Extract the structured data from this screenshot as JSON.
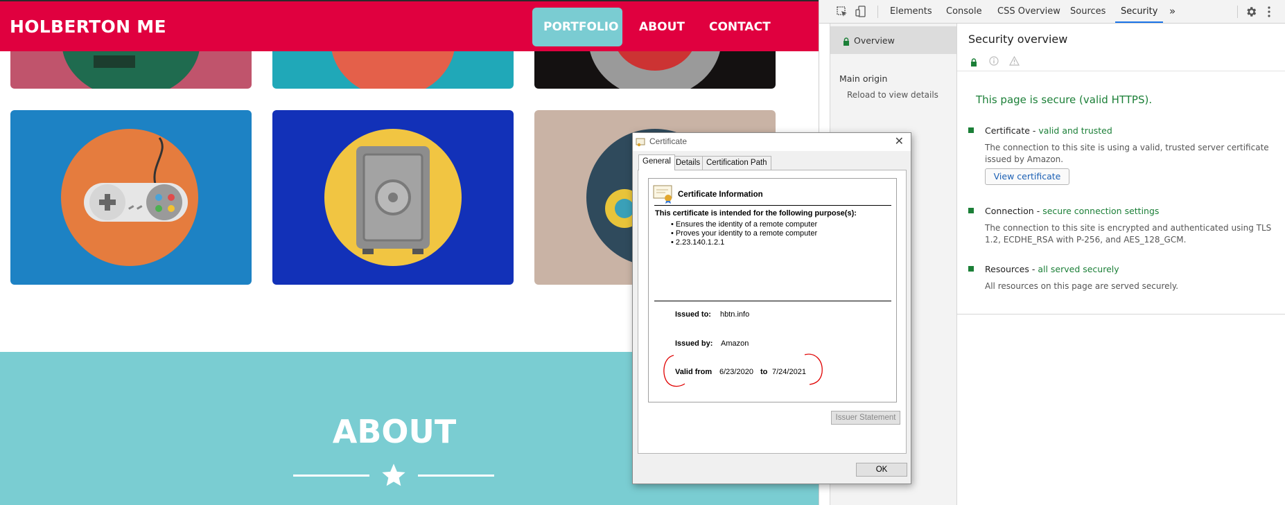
{
  "site": {
    "brand": "HOLBERTON ME",
    "nav": {
      "portfolio": "PORTFOLIO",
      "about": "ABOUT",
      "contact": "CONTACT"
    },
    "about_title": "ABOUT",
    "colors": {
      "navbar": "#e0003f",
      "accent": "#7accd2"
    },
    "portfolio_tiles": [
      {
        "name": "cabin",
        "color": "#c0546c"
      },
      {
        "name": "cake",
        "color": "#20a8b8"
      },
      {
        "name": "circus",
        "color": "#141111"
      },
      {
        "name": "game-controller",
        "color": "#1d82c4"
      },
      {
        "name": "safe",
        "color": "#1231b8"
      },
      {
        "name": "submarine",
        "color": "#c9b3a5"
      }
    ]
  },
  "devtools": {
    "tabs": [
      "Elements",
      "Console",
      "CSS Overview",
      "Sources",
      "Security"
    ],
    "active_tab": "Security",
    "more_tabs": "»",
    "sidebar": {
      "overview": "Overview",
      "main_origin": "Main origin",
      "reload_hint": "Reload to view details"
    },
    "security": {
      "title": "Security overview",
      "summary": "This page is secure (valid HTTPS).",
      "certificate": {
        "label": "Certificate",
        "status": "valid and trusted",
        "description": "The connection to this site is using a valid, trusted server certificate issued by Amazon.",
        "button": "View certificate"
      },
      "connection": {
        "label": "Connection",
        "status": "secure connection settings",
        "description": "The connection to this site is encrypted and authenticated using TLS 1.2, ECDHE_RSA with P-256, and AES_128_GCM."
      },
      "resources": {
        "label": "Resources",
        "status": "all served securely",
        "description": "All resources on this page are served securely."
      },
      "status_color": "#1b7f37"
    }
  },
  "certificate_dialog": {
    "title": "Certificate",
    "tabs": [
      "General",
      "Details",
      "Certification Path"
    ],
    "active_tab": "General",
    "info_heading": "Certificate Information",
    "purpose_heading": "This certificate is intended for the following purpose(s):",
    "purposes": [
      "Ensures the identity of a remote computer",
      "Proves your identity to a remote computer",
      "2.23.140.1.2.1"
    ],
    "issued_to_label": "Issued to:",
    "issued_to": "hbtn.info",
    "issued_by_label": "Issued by:",
    "issued_by": "Amazon",
    "valid_from_label": "Valid from",
    "valid_from": "6/23/2020",
    "valid_to_label": "to",
    "valid_to": "7/24/2021",
    "issuer_statement_button": "Issuer Statement",
    "ok_button": "OK"
  }
}
